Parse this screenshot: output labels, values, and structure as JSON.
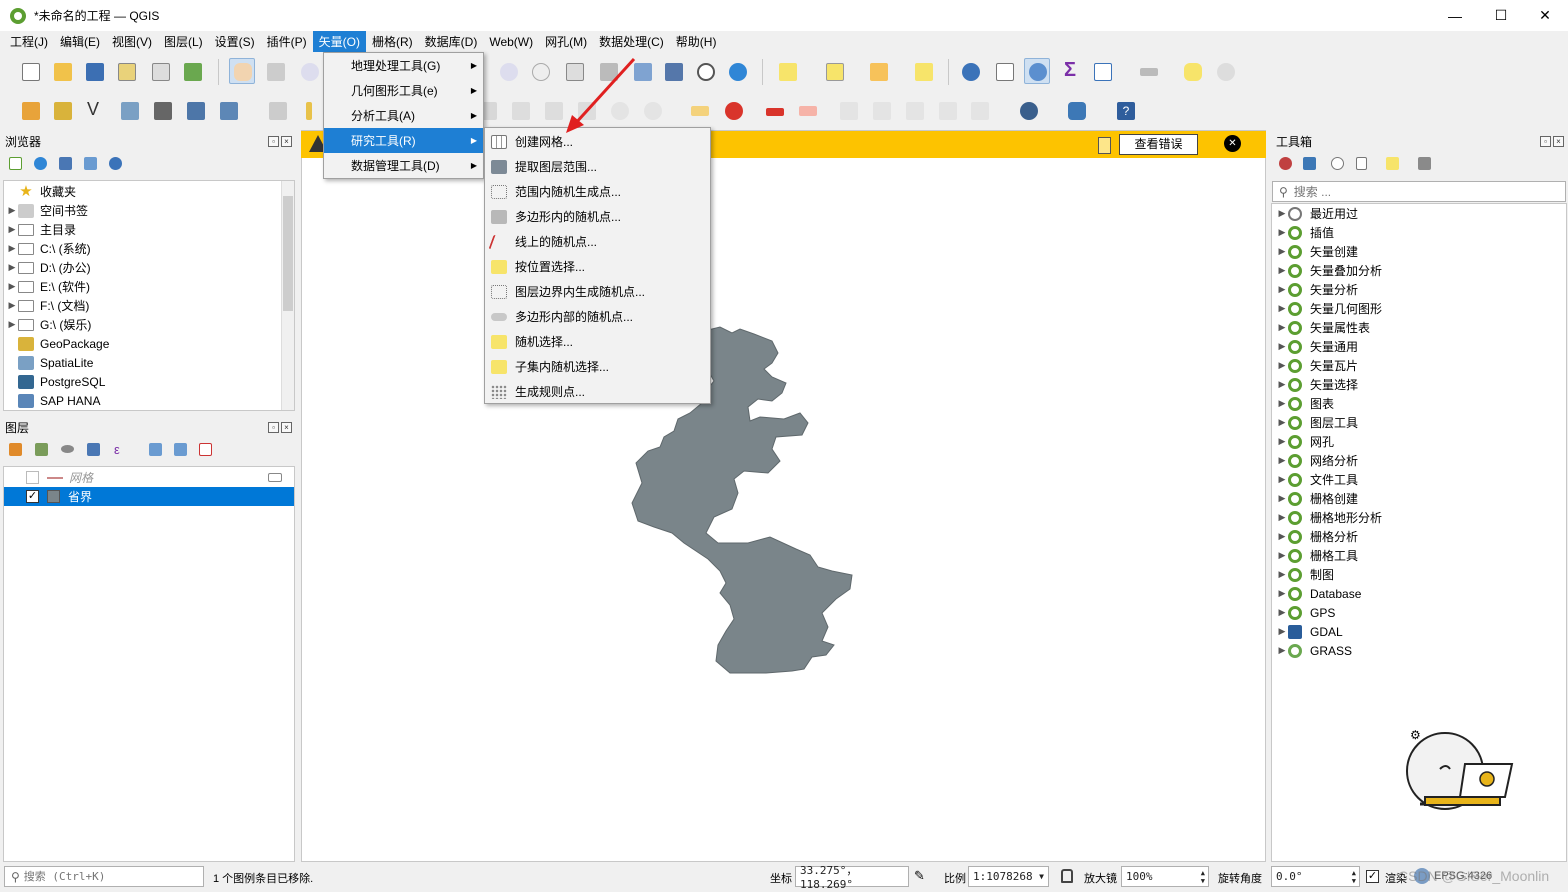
{
  "window": {
    "title": "*未命名的工程 — QGIS",
    "minimize": "—",
    "maximize": "☐",
    "close": "✕"
  },
  "menubar": [
    "工程(J)",
    "编辑(E)",
    "视图(V)",
    "图层(L)",
    "设置(S)",
    "插件(P)",
    "矢量(O)",
    "栅格(R)",
    "数据库(D)",
    "Web(W)",
    "网孔(M)",
    "数据处理(C)",
    "帮助(H)"
  ],
  "vector_menu": [
    "地理处理工具(G)",
    "几何图形工具(e)",
    "分析工具(A)",
    "研究工具(R)",
    "数据管理工具(D)"
  ],
  "research_tools_menu": [
    "创建网格...",
    "提取图层范围...",
    "范围内随机生成点...",
    "多边形内的随机点...",
    "线上的随机点...",
    "按位置选择...",
    "图层边界内生成随机点...",
    "多边形内部的随机点...",
    "随机选择...",
    "子集内随机选择...",
    "生成规则点..."
  ],
  "message_bar": {
    "button": "查看错误",
    "close": "✕"
  },
  "browser": {
    "title": "浏览器",
    "items": [
      "收藏夹",
      "空间书签",
      "主目录",
      "C:\\ (系统)",
      "D:\\ (办公)",
      "E:\\ (软件)",
      "F:\\ (文档)",
      "G:\\ (娱乐)",
      "GeoPackage",
      "SpatiaLite",
      "PostgreSQL",
      "SAP HANA"
    ]
  },
  "layers": {
    "title": "图层",
    "items": [
      {
        "name": "网格",
        "checked": false
      },
      {
        "name": "省界",
        "checked": true
      }
    ]
  },
  "toolbox": {
    "title": "工具箱",
    "search_placeholder": "搜索 ...",
    "items": [
      "最近用过",
      "插值",
      "矢量创建",
      "矢量叠加分析",
      "矢量分析",
      "矢量几何图形",
      "矢量属性表",
      "矢量通用",
      "矢量瓦片",
      "矢量选择",
      "图表",
      "图层工具",
      "网孔",
      "网络分析",
      "文件工具",
      "栅格创建",
      "栅格地形分析",
      "栅格分析",
      "栅格工具",
      "制图",
      "Database",
      "GPS",
      "GDAL",
      "GRASS"
    ]
  },
  "statusbar": {
    "search_placeholder": "搜索 (Ctrl+K)",
    "message": "1 个图例条目已移除.",
    "coord_label": "坐标",
    "coord_value": "33.275°，118.269°",
    "scale_label": "比例",
    "scale_value": "1:1078268",
    "magnifier_label": "放大镜",
    "magnifier_value": "100%",
    "rotation_label": "旋转角度",
    "rotation_value": "0.0°",
    "render_label": "渲染",
    "crs_value": "EPSG:4326",
    "watermark": "CSDN @GISer_Moonlin"
  },
  "colors": {
    "accent": "#1e7fd4",
    "message_bar": "#fdc300",
    "polygon_fill": "#7a858a",
    "qgis_green": "#5c9e31"
  }
}
